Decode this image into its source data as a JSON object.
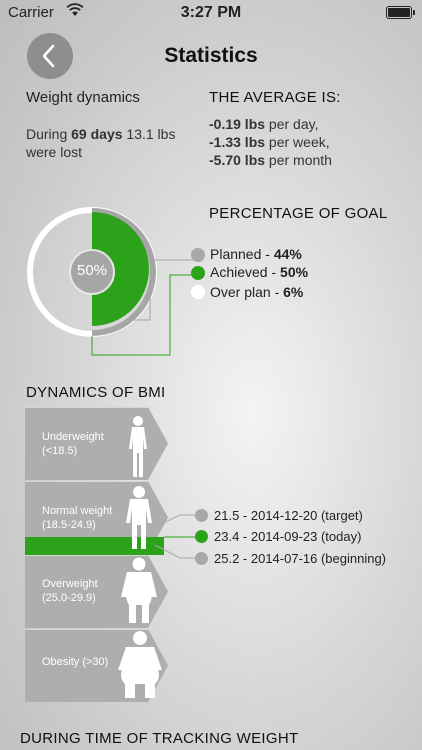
{
  "status_bar": {
    "carrier": "Carrier",
    "time": "3:27 PM"
  },
  "header": {
    "title": "Statistics"
  },
  "weight_dynamics": {
    "heading": "Weight dynamics",
    "during": "During",
    "days": "69 days",
    "lost_text": "13.1 lbs",
    "were_lost": "were lost"
  },
  "average": {
    "heading": "THE AVERAGE IS:",
    "rows": [
      {
        "value": "-0.19 lbs",
        "unit": "per day,"
      },
      {
        "value": "-1.33 lbs",
        "unit": "per week,"
      },
      {
        "value": "-5.70 lbs",
        "unit": "per month"
      }
    ]
  },
  "goal": {
    "heading": "PERCENTAGE OF GOAL",
    "center_label": "50%",
    "planned_fraction": 0.44,
    "achieved_fraction": 0.5,
    "legend": [
      {
        "label": "Planned - ",
        "value": "44%",
        "color": "#a8a8a8"
      },
      {
        "label": "Achieved - ",
        "value": "50%",
        "color": "#2ca21b"
      },
      {
        "label": "Over plan - ",
        "value": "6%",
        "color": "#ffffff"
      }
    ]
  },
  "bmi": {
    "heading": "DYNAMICS OF BMI",
    "bands": [
      {
        "name": "Underweight",
        "range": "(<18.5)"
      },
      {
        "name": "Normal weight",
        "range": "(18.5-24.9)"
      },
      {
        "name": "Overweight",
        "range": "(25.0-29.9)"
      },
      {
        "name": "Obesity (>30)",
        "range": ""
      }
    ],
    "markers": [
      {
        "text": "21.5 - 2014-12-20 (target)",
        "color": "#a8a8a8"
      },
      {
        "text": "23.4 - 2014-09-23 (today)",
        "color": "#2ca21b"
      },
      {
        "text": "25.2 - 2014-07-16 (beginning)",
        "color": "#a8a8a8"
      }
    ]
  },
  "footer": {
    "heading": "DURING TIME OF TRACKING WEIGHT"
  }
}
